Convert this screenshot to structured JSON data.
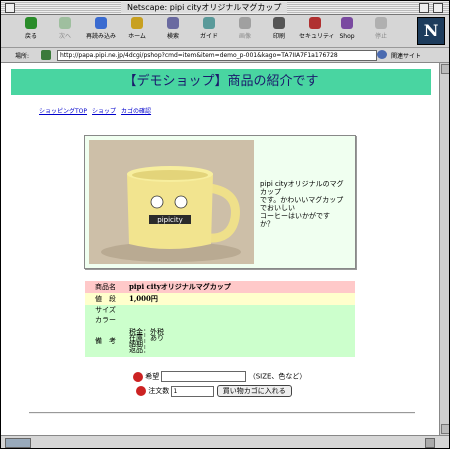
{
  "window": {
    "title": "Netscape: pipi cityオリジナルマグカップ"
  },
  "toolbar": {
    "items": [
      {
        "label": "戻る",
        "color": "#2a8c2a"
      },
      {
        "label": "次へ",
        "color": "#9fbf9f"
      },
      {
        "label": "再読み込み",
        "color": "#3a6bd0"
      },
      {
        "label": "ホーム",
        "color": "#c8a020"
      },
      {
        "label": "検索",
        "color": "#6a6aa0"
      },
      {
        "label": "ガイド",
        "color": "#5a9a9a"
      },
      {
        "label": "画像",
        "color": "#a0a0a0"
      },
      {
        "label": "印刷",
        "color": "#555555"
      },
      {
        "label": "セキュリティ",
        "color": "#b03030"
      },
      {
        "label": "Shop",
        "color": "#7a4aa0"
      },
      {
        "label": "停止",
        "color": "#b0b0b0"
      }
    ],
    "logo": "N"
  },
  "location": {
    "label": "場所:",
    "url": "http://papa.pipi.ne.jp/4dcgi/pshop?cmd=item&item=demo_p-001&kago=TA7IIA7F1a176728",
    "related": "関連サイト"
  },
  "page": {
    "banner": "【デモショップ】商品の紹介です",
    "nav": [
      "ショッピングTOP",
      "ショップ",
      "カゴの確認"
    ],
    "mug_print": "pipicity",
    "description": [
      "pipi cityオリジナルのマグ",
      "カップ",
      "です。かわいいマグカップ",
      "でおいしい",
      "コーヒーはいかがです",
      "か？"
    ],
    "spec": {
      "name_label": "商品名",
      "name_value": "pipi cityオリジナルマグカップ",
      "price_label": "値　段",
      "price_value": "1,000円",
      "size_label": "サイズ",
      "color_label": "カラー",
      "note_label": "備　考",
      "note_lines": [
        "税金：外税",
        "在庫：あり",
        "納期：",
        "返品："
      ]
    },
    "form": {
      "request_label": "希望",
      "request_hint": "（SIZE、色など）",
      "qty_label": "注文数",
      "qty_value": "1",
      "add_button": "買い物カゴに入れる"
    }
  }
}
